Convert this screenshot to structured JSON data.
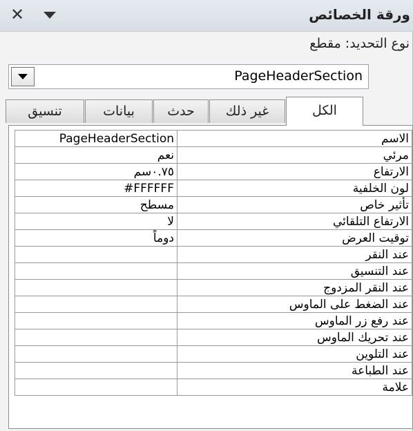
{
  "window": {
    "title": "ورقة الخصائص",
    "close_icon": "close-icon",
    "menu_icon": "chevron-down-icon"
  },
  "selection_type": "نوع التحديد: مقطع",
  "selector": {
    "value": "PageHeaderSection"
  },
  "tabs": [
    {
      "label": "الكل",
      "active": true
    },
    {
      "label": "غير ذلك"
    },
    {
      "label": "حدث"
    },
    {
      "label": "بيانات"
    },
    {
      "label": "تنسيق"
    }
  ],
  "properties": [
    {
      "name": "الاسم",
      "value": "PageHeaderSection"
    },
    {
      "name": "مرئي",
      "value": "نعم"
    },
    {
      "name": "الارتفاع",
      "value": "٠.٧٥سم"
    },
    {
      "name": "لون الخلفية",
      "value": "#FFFFFF"
    },
    {
      "name": "تأثير خاص",
      "value": "مسطح"
    },
    {
      "name": "الارتفاع التلقائي",
      "value": "لا"
    },
    {
      "name": "توقيت العرض",
      "value": "دوماً"
    },
    {
      "name": "عند النقر",
      "value": ""
    },
    {
      "name": "عند التنسيق",
      "value": ""
    },
    {
      "name": "عند النقر المزدوج",
      "value": ""
    },
    {
      "name": "عند الضغط على الماوس",
      "value": ""
    },
    {
      "name": "عند رفع زر الماوس",
      "value": ""
    },
    {
      "name": "عند تحريك الماوس",
      "value": ""
    },
    {
      "name": "عند التلوين",
      "value": ""
    },
    {
      "name": "عند الطباعة",
      "value": ""
    },
    {
      "name": "علامة",
      "value": ""
    }
  ]
}
